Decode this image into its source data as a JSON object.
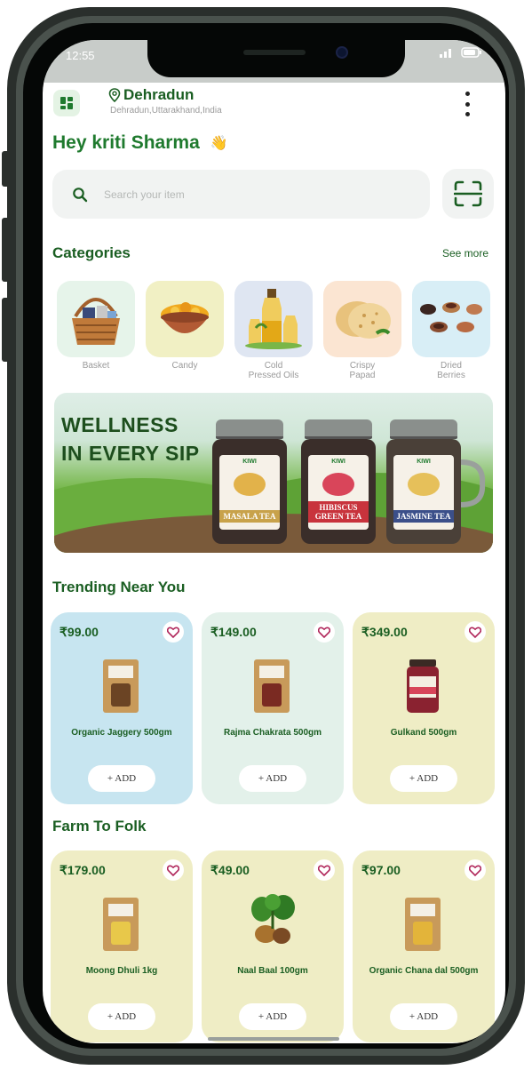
{
  "status_bar": {
    "time": "12:55"
  },
  "header": {
    "location_city": "Dehradun",
    "location_detail": "Dehradun,Uttarakhand,India",
    "greeting": "Hey kriti Sharma",
    "greeting_emoji": "👋"
  },
  "search": {
    "placeholder": "Search your item",
    "value": ""
  },
  "categories": {
    "title": "Categories",
    "see_more": "See more",
    "items": [
      {
        "label": "Basket",
        "bg": "#e6f4ea"
      },
      {
        "label": "Candy",
        "bg": "#f1f0c4"
      },
      {
        "label": "Cold Pressed Oils",
        "bg": "#dfe6f2"
      },
      {
        "label": "Crispy Papad",
        "bg": "#fbe5d2"
      },
      {
        "label": "Dried Berries",
        "bg": "#d8eef6"
      }
    ]
  },
  "banner": {
    "headline_1": "WELLNESS",
    "headline_2": "IN EVERY SIP",
    "jars": [
      {
        "name": "MASALA TEA",
        "band": "#c8a24a"
      },
      {
        "name": "HIBISCUS GREEN TEA",
        "band": "#c8333c"
      },
      {
        "name": "JASMINE TEA",
        "band": "#3b4f8a"
      }
    ],
    "brand": "KIWI"
  },
  "trending": {
    "title": "Trending Near You",
    "products": [
      {
        "price": "₹99.00",
        "name": "Organic Jaggery 500gm",
        "add": "+ ADD",
        "bg": "#c7e5f0"
      },
      {
        "price": "₹149.00",
        "name": "Rajma Chakrata 500gm",
        "add": "+ ADD",
        "bg": "#e3f1ea"
      },
      {
        "price": "₹349.00",
        "name": "Gulkand 500gm",
        "add": "+ ADD",
        "bg": "#efedc5"
      }
    ]
  },
  "farm": {
    "title": "Farm To Folk",
    "products": [
      {
        "price": "₹179.00",
        "name": "Moong Dhuli 1kg",
        "add": "+ ADD",
        "bg": "#efedc5"
      },
      {
        "price": "₹49.00",
        "name": "Naal Baal 100gm",
        "add": "+ ADD",
        "bg": "#efedc5"
      },
      {
        "price": "₹97.00",
        "name": "Organic Chana dal 500gm",
        "add": "+ ADD",
        "bg": "#efedc5"
      }
    ]
  },
  "colors": {
    "brand_green": "#1f7a2e",
    "heart": "#b0265a"
  }
}
